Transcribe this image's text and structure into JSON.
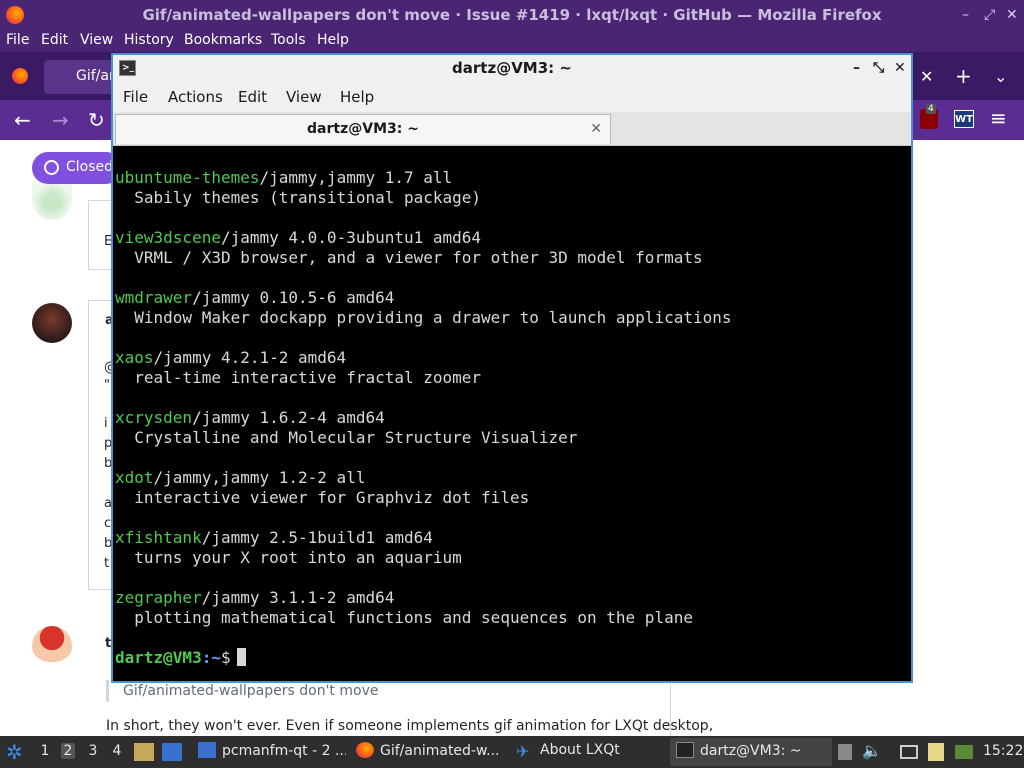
{
  "firefox": {
    "window_title": "Gif/animated-wallpapers don't move · Issue #1419 · lxqt/lxqt · GitHub — Mozilla Firefox",
    "menu": [
      "File",
      "Edit",
      "View",
      "History",
      "Bookmarks",
      "Tools",
      "Help"
    ],
    "tab_label": "Gif/an",
    "ubo_count": "4",
    "wt_label": "WT",
    "issue_state": "Closed",
    "quote_text": "Gif/animated-wallpapers don't move",
    "paragraph_text": "In short, they won't ever. Even if someone implements gif animation for LXQt desktop,",
    "fragments": [
      "E",
      "a",
      "@",
      "\"",
      "i",
      "p",
      "b",
      "a",
      "c",
      "b",
      "t",
      "t"
    ]
  },
  "terminal": {
    "title": "dartz@VM3: ~",
    "menu": [
      "File",
      "Actions",
      "Edit",
      "View",
      "Help"
    ],
    "tab_label": "dartz@VM3: ~",
    "packages": [
      {
        "name": "ubuntume-themes",
        "rest": "/jammy,jammy 1.7 all",
        "desc": "  Sabily themes (transitional package)"
      },
      {
        "name": "view3dscene",
        "rest": "/jammy 4.0.0-3ubuntu1 amd64",
        "desc": "  VRML / X3D browser, and a viewer for other 3D model formats"
      },
      {
        "name": "wmdrawer",
        "rest": "/jammy 0.10.5-6 amd64",
        "desc": "  Window Maker dockapp providing a drawer to launch applications"
      },
      {
        "name": "xaos",
        "rest": "/jammy 4.2.1-2 amd64",
        "desc": "  real-time interactive fractal zoomer"
      },
      {
        "name": "xcrysden",
        "rest": "/jammy 1.6.2-4 amd64",
        "desc": "  Crystalline and Molecular Structure Visualizer"
      },
      {
        "name": "xdot",
        "rest": "/jammy,jammy 1.2-2 all",
        "desc": "  interactive viewer for Graphviz dot files"
      },
      {
        "name": "xfishtank",
        "rest": "/jammy 2.5-1build1 amd64",
        "desc": "  turns your X root into an aquarium"
      },
      {
        "name": "zegrapher",
        "rest": "/jammy 3.1.1-2 amd64",
        "desc": "  plotting mathematical functions and sequences on the plane"
      }
    ],
    "prompt_user": "dartz@VM3",
    "prompt_path": ":~",
    "prompt_symbol": "$"
  },
  "taskbar": {
    "desktops": [
      "1",
      "2",
      "3",
      "4"
    ],
    "active_desktop": "2",
    "windows": [
      {
        "label": "pcmanfm-qt - 2 ..."
      },
      {
        "label": "Gif/animated-w..."
      },
      {
        "label": "About LXQt"
      },
      {
        "label": "dartz@VM3: ~"
      }
    ],
    "clock": "15:22"
  }
}
